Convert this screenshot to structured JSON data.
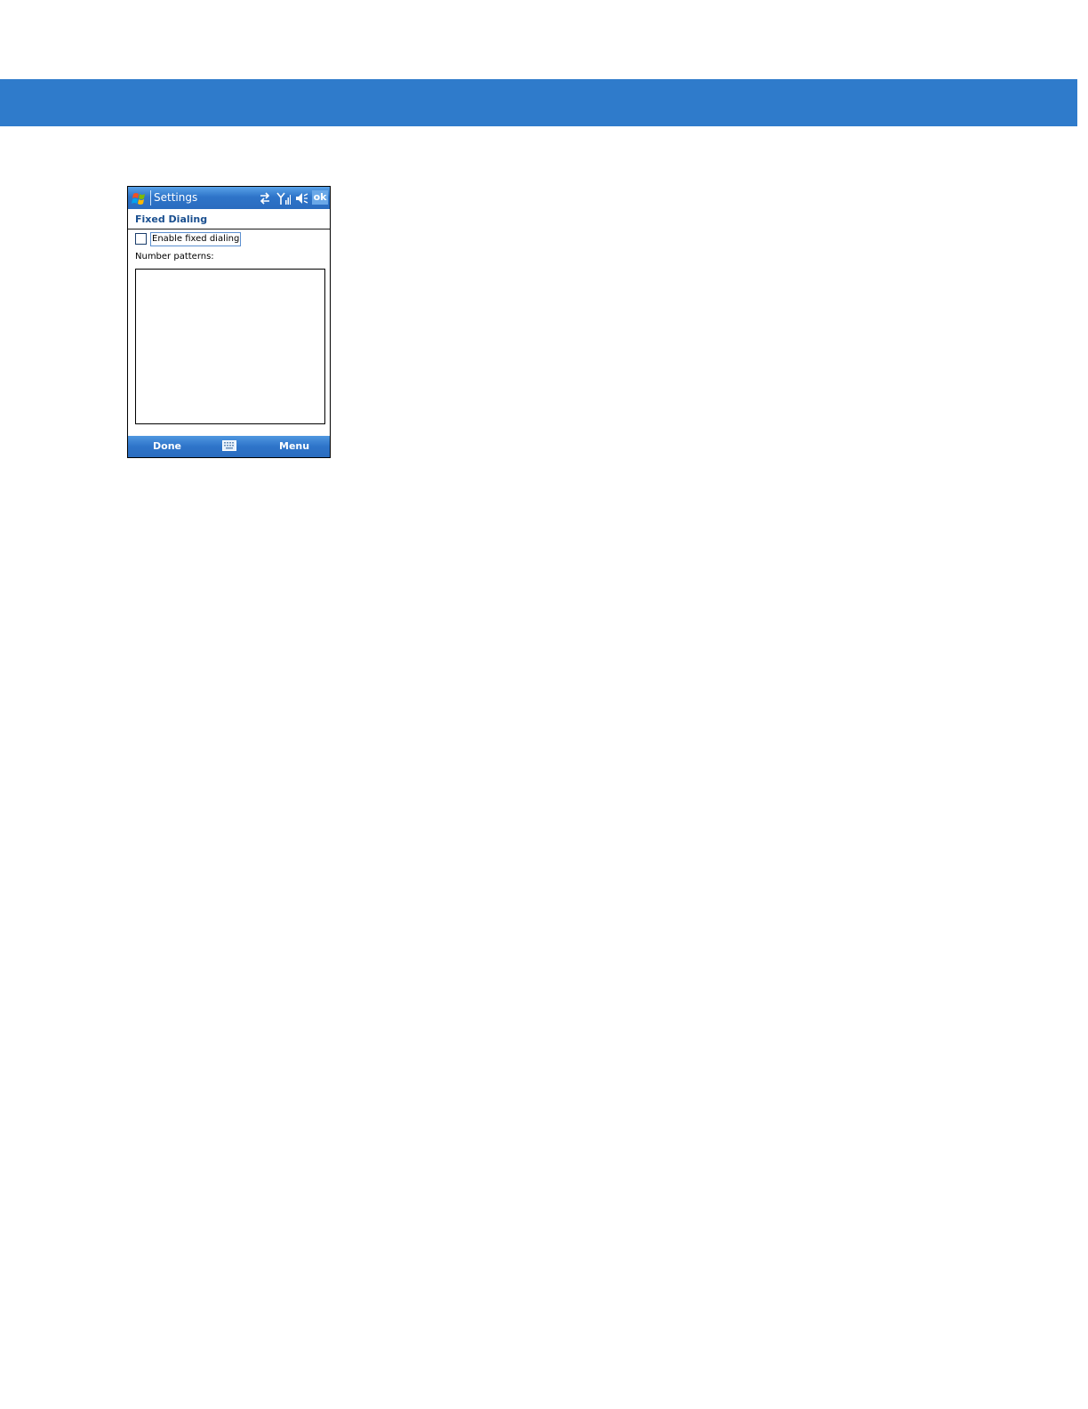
{
  "titlebar": {
    "title": "Settings",
    "ok_label": "ok",
    "icons": [
      "windows-start-icon",
      "connectivity-icon",
      "signal-icon",
      "speaker-icon"
    ]
  },
  "screen": {
    "heading": "Fixed Dialing",
    "enable_label": "Enable fixed dialing",
    "enable_checked": false,
    "patterns_label": "Number patterns:",
    "patterns_value": ""
  },
  "menubar": {
    "left_softkey": "Done",
    "right_softkey": "Menu",
    "center_icon": "keyboard-icon"
  },
  "colors": {
    "page_band": "#2f7bcb",
    "titlebar": "#2e74c9",
    "heading_text": "#1a4f8f"
  }
}
